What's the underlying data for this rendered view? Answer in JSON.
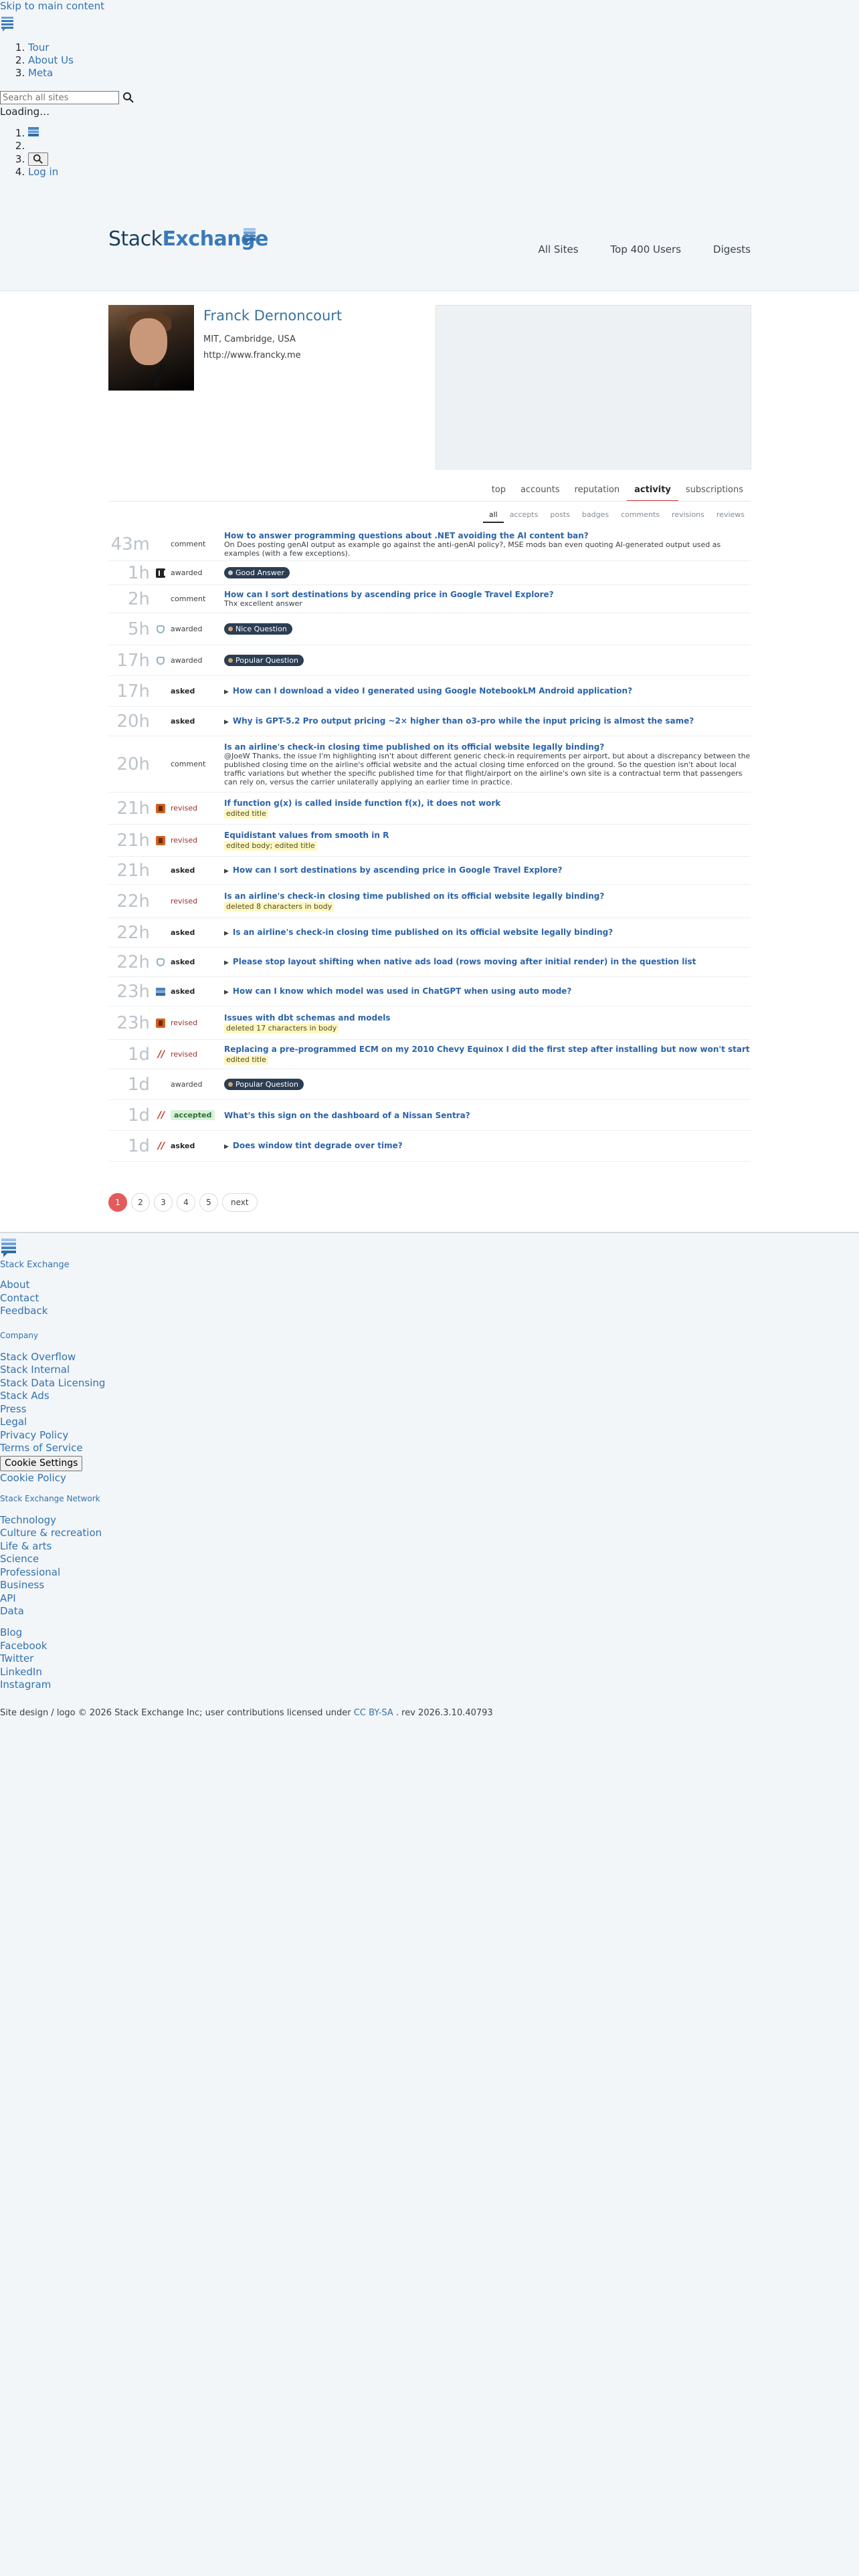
{
  "topbar": {
    "skip_link": "Skip to main content",
    "nav": [
      "Tour",
      "About Us",
      "Meta"
    ],
    "search_placeholder": "Search all sites",
    "loading": "Loading…",
    "login": "Log in"
  },
  "header": {
    "brand_part1": "Stack",
    "brand_part2": "Exchange",
    "nav": [
      "All Sites",
      "Top 400 Users",
      "Digests"
    ]
  },
  "profile": {
    "name": "Franck Dernoncourt",
    "location": "MIT, Cambridge, USA",
    "website": "http://www.francky.me"
  },
  "tabs": [
    {
      "label": "top",
      "active": false
    },
    {
      "label": "accounts",
      "active": false
    },
    {
      "label": "reputation",
      "active": false
    },
    {
      "label": "activity",
      "active": true
    },
    {
      "label": "subscriptions",
      "active": false
    }
  ],
  "subtabs": [
    {
      "label": "all",
      "active": true
    },
    {
      "label": "accepts",
      "active": false
    },
    {
      "label": "posts",
      "active": false
    },
    {
      "label": "badges",
      "active": false
    },
    {
      "label": "comments",
      "active": false
    },
    {
      "label": "revisions",
      "active": false
    },
    {
      "label": "reviews",
      "active": false
    }
  ],
  "activity": [
    {
      "time": "43m",
      "site": "none",
      "kind": "comment",
      "title": "How to answer programming questions about .NET avoiding the AI content ban?",
      "desc": "On Does posting genAI output as example go against the anti-genAI policy?, MSE mods ban even quoting AI-generated output used as examples (with a few exceptions).",
      "h": 50
    },
    {
      "time": "1h",
      "site": "meta",
      "kind": "awarded",
      "badge": "Good Answer",
      "badge_color": "#c9c9c9",
      "h": 36
    },
    {
      "time": "2h",
      "site": "none",
      "kind": "comment",
      "title": "How can I sort destinations by ascending price in Google Travel Explore?",
      "desc": "Thx excellent answer",
      "h": 42
    },
    {
      "time": "5h",
      "site": "ux",
      "kind": "awarded",
      "badge": "Nice Question",
      "badge_color": "#cda36b",
      "h": 48
    },
    {
      "time": "17h",
      "site": "ux",
      "kind": "awarded",
      "badge": "Popular Question",
      "badge_color": "#cda36b",
      "h": 46
    },
    {
      "time": "17h",
      "site": "none",
      "kind": "asked",
      "question": true,
      "title": "How can I download a video I generated using Google NotebookLM Android application?",
      "h": 46
    },
    {
      "time": "20h",
      "site": "none",
      "kind": "asked",
      "question": true,
      "title": "Why is GPT-5.2 Pro output pricing ~2× higher than o3-pro while the input pricing is almost the same?",
      "h": 44
    },
    {
      "time": "20h",
      "site": "none",
      "kind": "comment",
      "title": "Is an airline's check-in closing time published on its official website legally binding?",
      "desc": "@JoeW Thanks, the issue I'm highlighting isn't about different generic check-in requirements per airport, but about a discrepancy between the published closing time on the airline's official website and the actual closing time enforced on the ground. So the question isn't about local traffic variations but whether the specific published time for that flight/airport on the airline's own site is a contractual term that passengers can rely on, versus the carrier unilaterally applying an earlier time in practice.",
      "h": 84
    },
    {
      "time": "21h",
      "site": "ai",
      "kind": "revised",
      "title": "If function g(x) is called inside function f(x), it does not work",
      "note": "edited title",
      "h": 48
    },
    {
      "time": "21h",
      "site": "ai",
      "kind": "revised",
      "title": "Equidistant values from smooth in R",
      "note": "edited body; edited title",
      "h": 48
    },
    {
      "time": "21h",
      "site": "none",
      "kind": "asked",
      "question": true,
      "title": "How can I sort destinations by ascending price in Google Travel Explore?",
      "h": 42
    },
    {
      "time": "22h",
      "site": "none",
      "kind": "revised",
      "title": "Is an airline's check-in closing time published on its official website legally binding?",
      "note": "deleted 8 characters in body",
      "h": 50
    },
    {
      "time": "22h",
      "site": "none",
      "kind": "asked",
      "question": true,
      "title": "Is an airline's check-in closing time published on its official website legally binding?",
      "h": 44
    },
    {
      "time": "22h",
      "site": "ux",
      "kind": "asked",
      "question": true,
      "title": "Please stop layout shifting when native ads load (rows moving after initial render) in the question list",
      "h": 44
    },
    {
      "time": "23h",
      "site": "se",
      "kind": "asked",
      "question": true,
      "title": "How can I know which model was used in ChatGPT when using auto mode?",
      "h": 44
    },
    {
      "time": "23h",
      "site": "ai",
      "kind": "revised",
      "title": "Issues with dbt schemas and models",
      "note": "deleted 17 characters in body",
      "h": 50
    },
    {
      "time": "1d",
      "site": "mech",
      "kind": "revised",
      "title": "Replacing a pre-programmed ECM on my 2010 Chevy Equinox I did the first step after installing but now won't start",
      "note": "edited title",
      "h": 44
    },
    {
      "time": "1d",
      "site": "none",
      "kind": "awarded",
      "badge": "Popular Question",
      "badge_color": "#cda36b",
      "h": 46
    },
    {
      "time": "1d",
      "site": "mech",
      "kind": "accepted",
      "title": "What's this sign on the dashboard of a Nissan Sentra?",
      "h": 46
    },
    {
      "time": "1d",
      "site": "mech",
      "kind": "asked",
      "question": true,
      "title": "Does window tint degrade over time?",
      "h": 46
    }
  ],
  "pager": [
    "1",
    "2",
    "3",
    "4",
    "5",
    "next"
  ],
  "footer": {
    "brand": "Stack Exchange",
    "col1": [
      "About",
      "Contact",
      "Feedback"
    ],
    "company_heading": "Company",
    "company": [
      "Stack Overflow",
      "Stack Internal",
      "Stack Data Licensing",
      "Stack Ads",
      "Press",
      "Legal",
      "Privacy Policy",
      "Terms of Service"
    ],
    "cookie_button": "Cookie Settings",
    "cookie_policy": "Cookie Policy",
    "network_heading": "Stack Exchange Network",
    "network": [
      "Technology",
      "Culture & recreation",
      "Life & arts",
      "Science",
      "Professional",
      "Business",
      "API",
      "Data"
    ],
    "social": [
      "Blog",
      "Facebook",
      "Twitter",
      "LinkedIn",
      "Instagram"
    ],
    "legal_prefix": "Site design / logo © 2026 Stack Exchange Inc; user contributions licensed under",
    "license": "CC BY-SA",
    "rev": ". rev 2026.3.10.40793"
  }
}
